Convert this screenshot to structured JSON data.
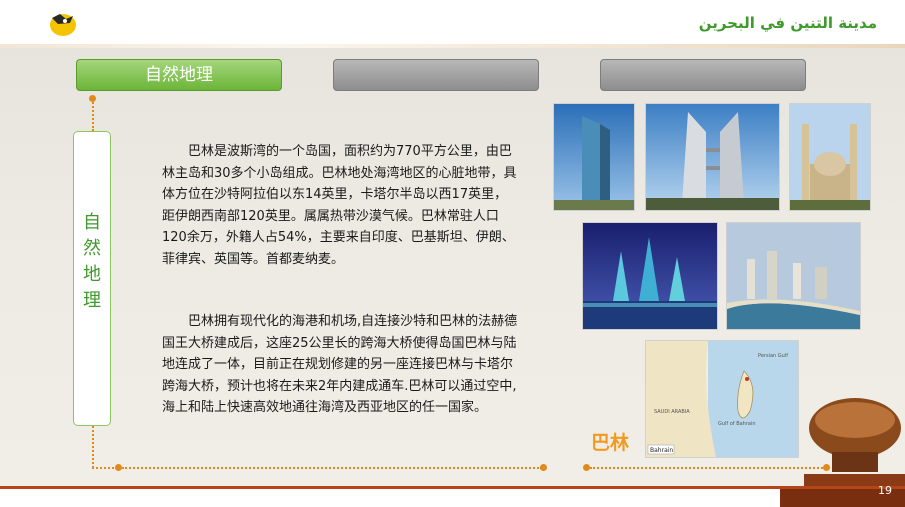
{
  "header": {
    "arabic_title": "مدينة التنين في البحرين"
  },
  "tabs": [
    {
      "label": "自然地理",
      "active": true
    },
    {
      "label": "",
      "active": false
    },
    {
      "label": "",
      "active": false
    }
  ],
  "side_label": "自然地理",
  "paragraphs": [
    "巴林是波斯湾的一个岛国，面积约为770平方公里，由巴林主岛和30多个小岛组成。巴林地处海湾地区的心脏地带，具体方位在沙特阿拉伯以东14英里，卡塔尔半岛以西17英里，距伊朗西南部120英里。属属热带沙漠气候。巴林常驻人口120余万，外籍人占54%，主要来自印度、巴基斯坦、伊朗、菲律宾、英国等。首都麦纳麦。",
    "巴林拥有现代化的海港和机场,自连接沙特和巴林的法赫德国王大桥建成后，这座25公里长的跨海大桥使得岛国巴林与陆地连成了一体，目前正在规划修建的另一座连接巴林与卡塔尔跨海大桥，预计也将在未来2年内建成通车.巴林可以通过空中,海上和陆上快速高效地通往海湾及西亚地区的任一国家。"
  ],
  "map": {
    "caption": "巴林",
    "label_bahrain": "Bahrain",
    "label_saudi": "SAUDI ARABIA",
    "label_gulf": "Gulf of Bahrain",
    "label_persian": "Persian Gulf"
  },
  "page_number": "19",
  "colors": {
    "accent_green": "#6bb539",
    "accent_orange": "#e08a1c",
    "caption_orange": "#f29a1f"
  }
}
